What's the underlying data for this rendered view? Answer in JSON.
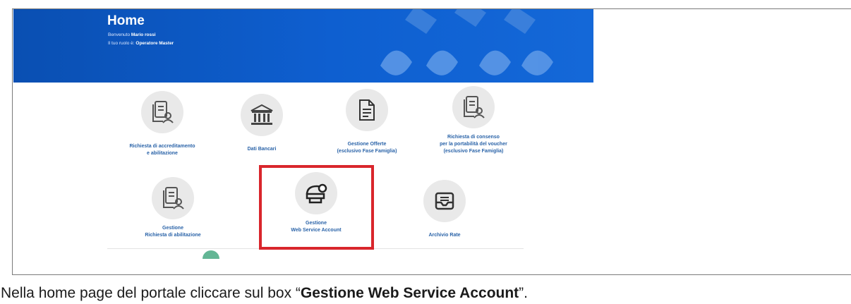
{
  "header": {
    "title": "Home",
    "welcome_prefix": "Benvenuto ",
    "user_name": "Mario rossi",
    "role_prefix": "Il tuo ruolo è: ",
    "role_name": "Operatore Master"
  },
  "tiles": [
    {
      "icon": "document-user-icon",
      "line1": "Richiesta di accreditamento",
      "line2": "e abilitazione",
      "line3": ""
    },
    {
      "icon": "bank-icon",
      "line1": "Dati Bancari",
      "line2": "",
      "line3": ""
    },
    {
      "icon": "document-icon",
      "line1": "Gestione Offerte",
      "line2": "(esclusivo Fase Famiglia)",
      "line3": ""
    },
    {
      "icon": "document-user-icon",
      "line1": "Richiesta di consenso",
      "line2": "per la portabilità del voucher",
      "line3": "(esclusivo Fase Famiglia)"
    },
    {
      "icon": "document-user-icon",
      "line1": "Gestione",
      "line2": "Richiesta di abilitazione",
      "line3": ""
    },
    {
      "icon": "web-service-icon",
      "line1": "Gestione",
      "line2": "Web Service Account",
      "line3": ""
    },
    {
      "icon": "inbox-icon",
      "line1": "Archivio Rate",
      "line2": "",
      "line3": ""
    }
  ],
  "caption": {
    "prefix": "Nella home page del portale cliccare sul box “",
    "bold": "Gestione Web Service Account",
    "suffix": "”."
  },
  "colors": {
    "banner": "#0e5fd0",
    "link": "#2a63a8",
    "highlight": "#d9262c"
  }
}
